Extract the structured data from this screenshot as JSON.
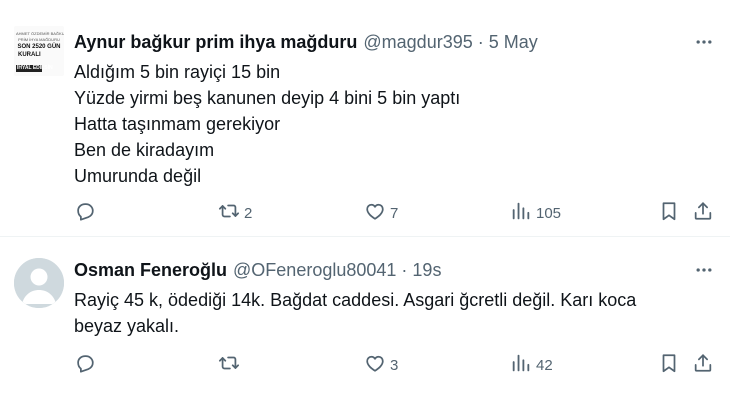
{
  "tweets": [
    {
      "author": {
        "name": "Aynur bağkur prim ihya mağduru",
        "handle": "@magdur395",
        "avatar_text": [
          "AHMET ÖZDEMİR BAĞKUR",
          "PRİM İHYA MAĞDURU",
          "SON 2520 GÜN",
          "KURALI",
          "İHYAL EDİLSİN"
        ]
      },
      "timestamp": "5 May",
      "separator": "·",
      "lines": [
        "Aldığım 5 bin rayiçi 15 bin",
        "Yüzde yirmi beş kanunen deyip 4 bini 5 bin yaptı",
        "Hatta taşınmam gerekiyor",
        "Ben de kiradayım",
        "Umurunda değil"
      ],
      "metrics": {
        "replies": "",
        "retweets": "2",
        "likes": "7",
        "views": "105"
      }
    },
    {
      "author": {
        "name": "Osman Feneroğlu",
        "handle": "@OFeneroglu80041"
      },
      "timestamp": "19s",
      "separator": "·",
      "text": "Rayiç 45 k, ödediği 14k. Bağdat caddesi. Asgari ğcretli değil. Karı koca beyaz yakalı.",
      "metrics": {
        "replies": "",
        "retweets": "",
        "likes": "3",
        "views": "42"
      }
    }
  ],
  "icons": {
    "reply": "reply-icon",
    "retweet": "retweet-icon",
    "like": "heart-icon",
    "views": "views-icon",
    "bookmark": "bookmark-icon",
    "share": "share-icon",
    "more": "more-icon"
  },
  "colors": {
    "text": "#0f1419",
    "muted": "#536471",
    "divider": "#eff3f4"
  }
}
